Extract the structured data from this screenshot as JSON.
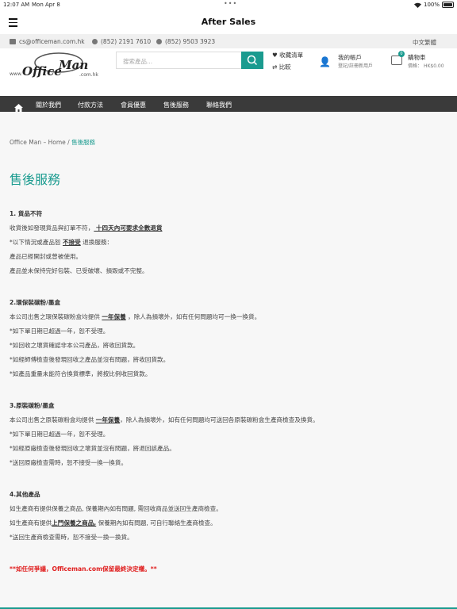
{
  "status": {
    "time": "12:07 AM",
    "date": "Mon Apr 8",
    "battery": "100%"
  },
  "nav": {
    "title": "After Sales"
  },
  "contact": {
    "email": "cs@officeman.com.hk",
    "phone": "(852) 2191 7610",
    "whatsapp": "(852) 9503 3923",
    "lang": "中文繁體"
  },
  "header": {
    "logo_text": "Office Man",
    "logo_sub": ".com.hk",
    "logo_www": "www",
    "search_placeholder": "搜索產品...",
    "wishlist": "收藏清單",
    "compare": "比較",
    "account": "我的帳戶",
    "account_sub": "登記/註冊新用戶",
    "cart": "購物車",
    "cart_price_label": "價格：",
    "cart_price": "HK$0.00",
    "cart_count": "0"
  },
  "menu": {
    "items": [
      "關於我們",
      "付款方法",
      "會員優惠",
      "售後服務",
      "聯絡我們"
    ]
  },
  "breadcrumb": {
    "home": "Office Man – Home",
    "sep": " / ",
    "current": "售後服務"
  },
  "page": {
    "title": "售後服務",
    "s1": {
      "h": "1. 貨品不符",
      "l1a": "收貨後如發現貨品與訂單不符，",
      "l1b": " 十四天內可要求全數退貨",
      "l2a": "*以下情況或產品恕 ",
      "l2b": "不接受",
      "l2c": " 退換服務：",
      "l3": "產品已經開封或曾被使用。",
      "l4": "產品並未保持完好包裝、已受破壞、損毀或不完整。"
    },
    "s2": {
      "h": "2.環保裝碳粉/墨盒",
      "l1a": "本公司出售之環保裝碳粉盒均提供 ",
      "l1b": "一年保養",
      "l1c": " ，除人為損壞外，如有任何問題均可一換一換貨。",
      "l2": "*如下單日期已超過一年，恕不受理。",
      "l3": "*如回收之壞貨確認非本公司產品，將收回貨款。",
      "l4": "*如經師傅檢查後發現回收之產品並沒有問題，將收回貨款。",
      "l5": "*如產品重量未能符合換貨標準，將按比例收回貨款。"
    },
    "s3": {
      "h": "3.原裝碳粉/墨盒",
      "l1a": "本公司出售之原裝碳粉盒均提供 ",
      "l1b": "一年保養",
      "l1c": "，除人為損壞外，如有任何問題均可送回各原裝碳粉盒生產商檢查及換貨。",
      "l2": "*如下單日期已超過一年，恕不受理。",
      "l3": "*如經原廠檢查後發現回收之壞貨並沒有問題，將退回該產品。",
      "l4": "*送回原廠檢查需時，恕不接受一換一換貨。"
    },
    "s4": {
      "h": "4.其他產品",
      "l1": "如生產商有提供保養之商品, 保養期內如有問題, 需回收商品並送回生產商檢查。",
      "l2a": "如生產商有提供",
      "l2b": "上門保養之商品,",
      "l2c": " 保養期內如有問題, 可自行聯絡生產商檢查。",
      "l3": "*送回生產商檢查需時，恕不接受一換一換貨。"
    },
    "note": "**如任何爭議，Officeman.com保留最終決定權。**"
  }
}
